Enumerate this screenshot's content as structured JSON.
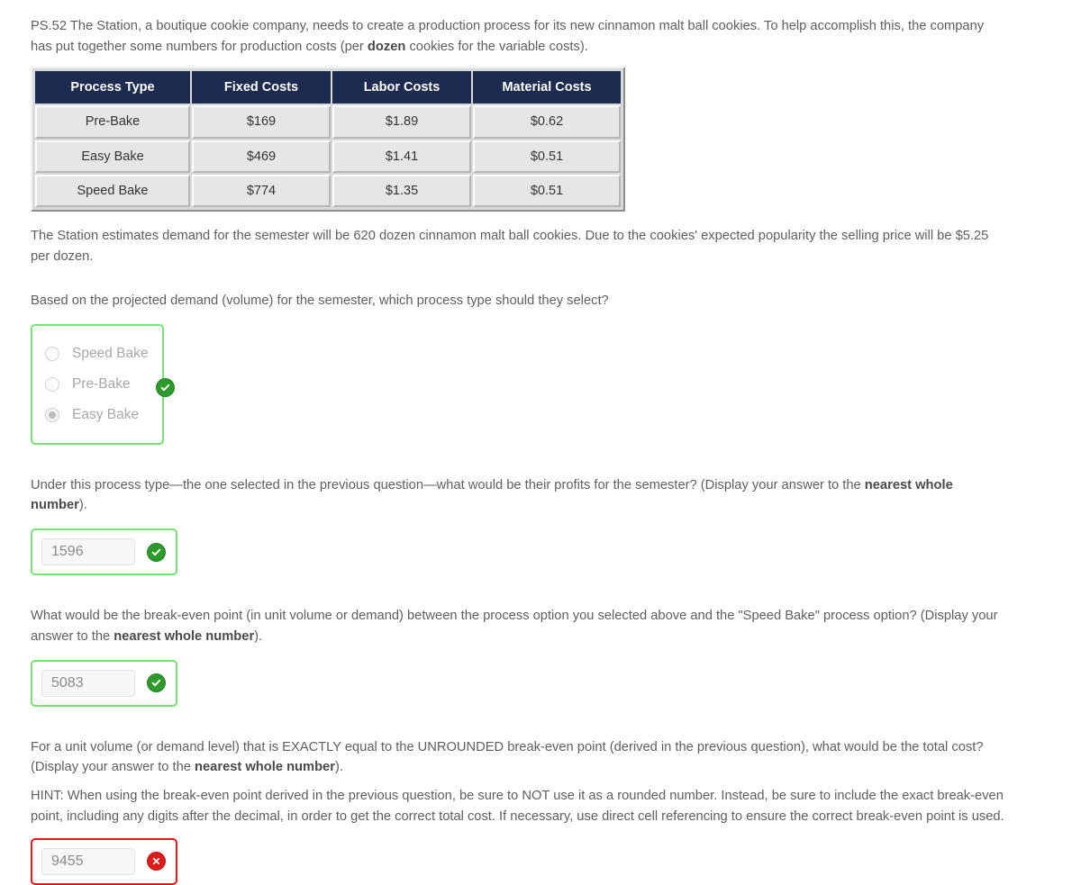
{
  "intro": {
    "text_part1": "PS.52 The Station, a boutique cookie company, needs to create a production process for its new cinnamon malt ball cookies. To help accomplish this, the company has put together some numbers for production costs (per ",
    "emphasis": "dozen",
    "text_part2": " cookies for the variable costs)."
  },
  "cost_table": {
    "headers": [
      "Process  Type",
      "Fixed Costs",
      "Labor Costs",
      "Material Costs"
    ],
    "rows": [
      [
        "Pre-Bake",
        "$169",
        "$1.89",
        "$0.62"
      ],
      [
        "Easy Bake",
        "$469",
        "$1.41",
        "$0.51"
      ],
      [
        "Speed Bake",
        "$774",
        "$1.35",
        "$0.51"
      ]
    ]
  },
  "demand_paragraph": "The Station estimates demand for the semester will be 620 dozen cinnamon malt ball cookies. Due to the cookies' expected popularity the selling price will be $5.25 per dozen.",
  "q1": {
    "prompt": "Based on the projected demand (volume) for the semester, which process type should they select?",
    "options": [
      {
        "label": "Speed Bake",
        "selected": false
      },
      {
        "label": "Pre-Bake",
        "selected": false
      },
      {
        "label": "Easy Bake",
        "selected": true
      }
    ],
    "status": "correct",
    "status_icon": "check-circle-icon"
  },
  "q2": {
    "prompt_part1": "Under this process type—the one selected in the previous question—what would be their profits for the semester? (Display your answer to the ",
    "emphasis": "nearest whole number",
    "prompt_part2": ").",
    "value": "1596",
    "placeholder": "",
    "status": "correct",
    "status_icon": "check-circle-icon"
  },
  "q3": {
    "prompt_part1": "What would be the break-even point (in unit volume or demand) between the process option you selected above and the \"Speed Bake\" process option? (Display your answer to the ",
    "emphasis": "nearest whole number",
    "prompt_part2": ").",
    "value": "5083",
    "placeholder": "",
    "status": "correct",
    "status_icon": "check-circle-icon"
  },
  "q4": {
    "prompt_part1": "For a unit volume (or demand level) that is EXACTLY equal to the UNROUNDED break-even point (derived in the previous question), what would be the total cost? (Display your answer to the ",
    "emphasis": "nearest whole number",
    "prompt_part2": ").",
    "hint": "HINT: When using the break-even point derived in the previous question, be sure to NOT use it as a rounded number.  Instead, be sure to include the exact break-even point, including any digits after the decimal, in order to get the correct total cost.  If necessary, use direct cell referencing to ensure the correct break-even point is used.",
    "value": "9455",
    "placeholder": "",
    "status": "incorrect",
    "status_icon": "x-circle-icon"
  },
  "colors": {
    "header_navy": "#1d2b50",
    "cell_gray": "#e6e6e6",
    "correct_green": "#2c9b2c",
    "correct_border": "#76e176",
    "incorrect_red": "#e01b1b",
    "incorrect_border": "#f11414",
    "body_text": "#5f5f5f"
  }
}
